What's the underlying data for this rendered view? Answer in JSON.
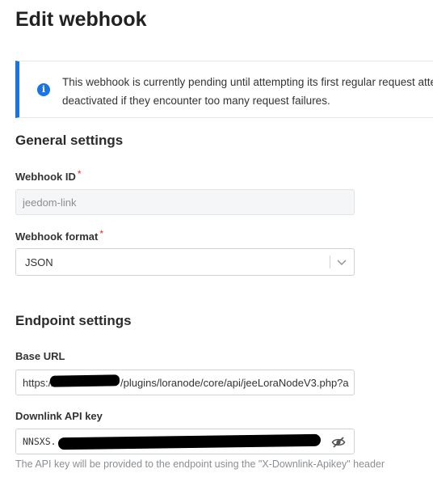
{
  "page": {
    "title": "Edit webhook"
  },
  "notice": {
    "line1": "This webhook is currently pending until attempting its first regular request atter",
    "line2": "deactivated if they encounter too many request failures.",
    "icon": "info-icon"
  },
  "general": {
    "title": "General settings",
    "webhook_id": {
      "label": "Webhook ID",
      "required": "*",
      "value": "jeedom-link"
    },
    "webhook_format": {
      "label": "Webhook format",
      "required": "*",
      "value": "JSON",
      "icon": "chevron-down-icon"
    }
  },
  "endpoint": {
    "title": "Endpoint settings",
    "base_url": {
      "label": "Base URL",
      "value_prefix": "https://",
      "value_suffix": "/plugins/loranode/core/api/jeeLoraNodeV3.php?a"
    },
    "downlink_api_key": {
      "label": "Downlink API key",
      "value_prefix": "NNSXS.",
      "hint": "The API key will be provided to the endpoint using the \"X-Downlink-Apikey\" header",
      "icon": "eye-off-icon"
    }
  },
  "colors": {
    "accent": "#1a73e8",
    "required": "#d93025"
  }
}
